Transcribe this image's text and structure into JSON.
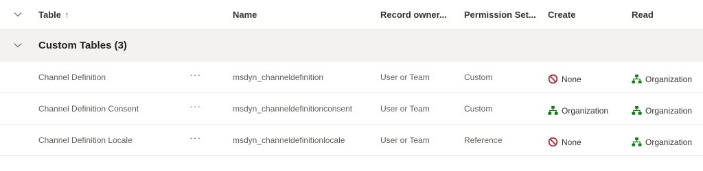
{
  "header": {
    "table_label": "Table",
    "table_sort_arrow": "↑",
    "name_label": "Name",
    "owner_label": "Record owner...",
    "permission_label": "Permission Set...",
    "create_label": "Create",
    "read_label": "Read"
  },
  "group": {
    "title": "Custom Tables (3)"
  },
  "rows": [
    {
      "table": "Channel Definition",
      "more": "···",
      "name": "msdyn_channeldefinition",
      "owner": "User or Team",
      "permission_set": "Custom",
      "create": "None",
      "create_icon": "none-icon",
      "read": "Organization",
      "read_icon": "organization-icon"
    },
    {
      "table": "Channel Definition Consent",
      "more": "···",
      "name": "msdyn_channeldefinitionconsent",
      "owner": "User or Team",
      "permission_set": "Custom",
      "create": "Organization",
      "create_icon": "organization-icon",
      "read": "Organization",
      "read_icon": "organization-icon"
    },
    {
      "table": "Channel Definition Locale",
      "more": "···",
      "name": "msdyn_channeldefinitionlocale",
      "owner": "User or Team",
      "permission_set": "Reference",
      "create": "None",
      "create_icon": "none-icon",
      "read": "Organization",
      "read_icon": "organization-icon"
    }
  ],
  "colors": {
    "none_icon": "#a4262c",
    "organization_icon": "#107c10"
  }
}
